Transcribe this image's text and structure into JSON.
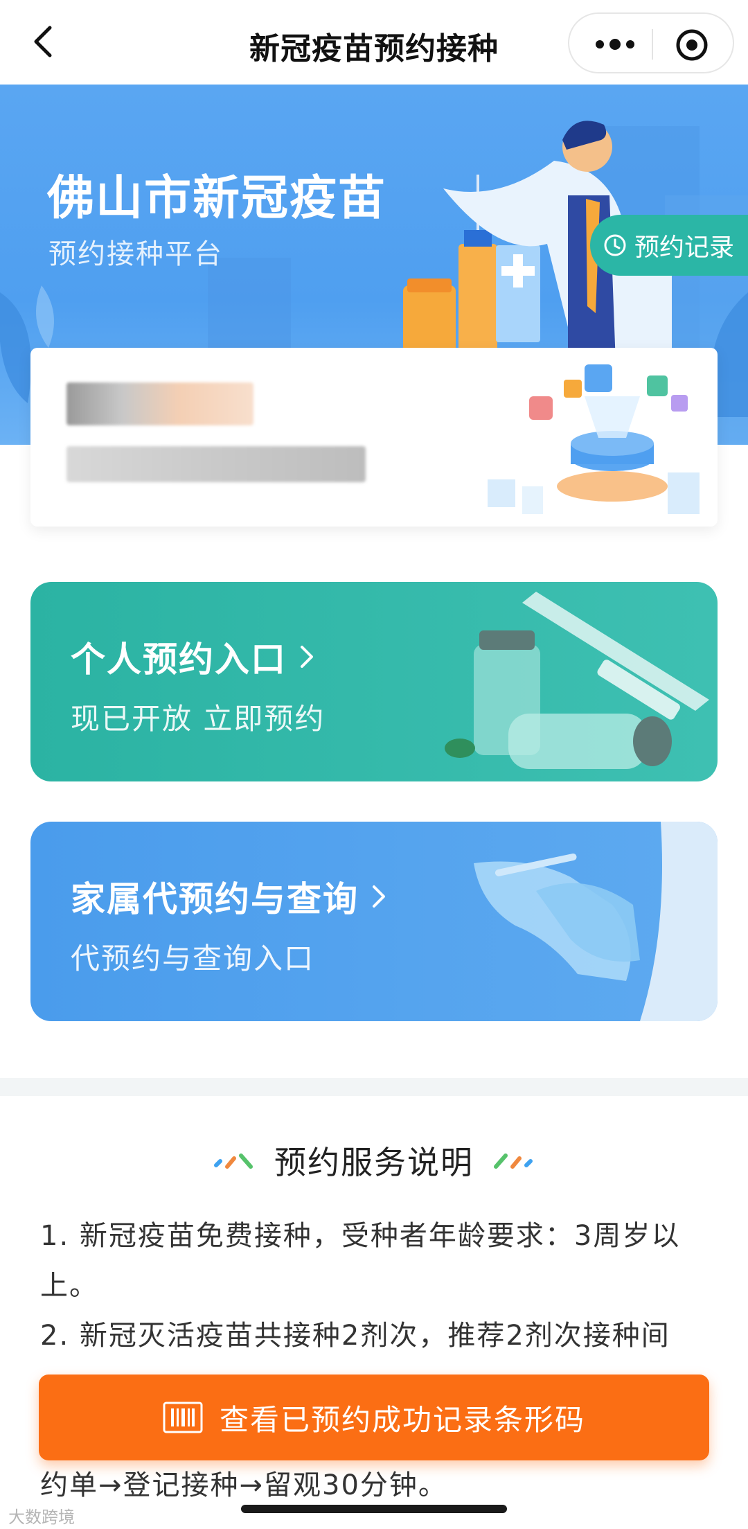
{
  "nav": {
    "title": "新冠疫苗预约接种"
  },
  "banner": {
    "title": "佛山市新冠疫苗",
    "subtitle": "预约接种平台",
    "record_label": "预约记录"
  },
  "entries": [
    {
      "title": "个人预约入口",
      "subtitle": "现已开放 立即预约",
      "color": "#2bb3a3"
    },
    {
      "title": "家属代预约与查询",
      "subtitle": "代预约与查询入口",
      "color": "#4a9cec"
    }
  ],
  "notes": {
    "heading": "预约服务说明",
    "line1": "1. 新冠疫苗免费接种，受种者年龄要求：3周岁以",
    "line2": "上。",
    "line3": "2. 新冠灭活疫苗共接种2剂次，推荐2剂次接种间",
    "tail": "约单→登记接种→留观30分钟。"
  },
  "bottom_button": {
    "label": "查看已预约成功记录条形码",
    "icon": "barcode-icon",
    "color": "#fb6e14"
  },
  "watermark": "大数跨境"
}
